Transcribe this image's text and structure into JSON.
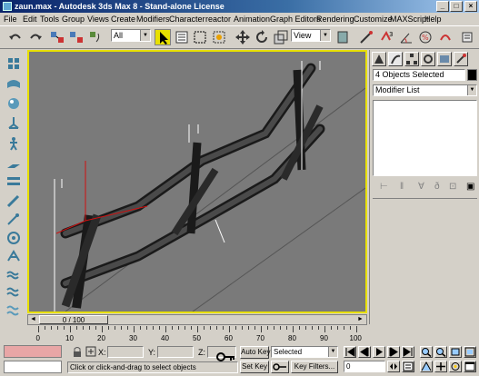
{
  "window": {
    "title": "zaun.max - Autodesk 3ds Max 8  - Stand-alone License",
    "min_glyph": "_",
    "max_glyph": "□",
    "close_glyph": "×"
  },
  "menu": [
    "File",
    "Edit",
    "Tools",
    "Group",
    "Views",
    "Create",
    "Modifiers",
    "Character",
    "reactor",
    "Animation",
    "Graph Editors",
    "Rendering",
    "Customize",
    "MAXScript",
    "Help"
  ],
  "toolbar": {
    "selection_filter": "All",
    "ref_coord": "View"
  },
  "viewport": {
    "label": "",
    "background": "#7a7a7a",
    "active_border": "#e8e000"
  },
  "time_slider": {
    "frame_display": "0 / 100",
    "prev_glyph": "◄",
    "next_glyph": "►"
  },
  "trackbar": {
    "ticks": [
      "0",
      "10",
      "20",
      "30",
      "40",
      "50",
      "60",
      "70",
      "80",
      "90",
      "100"
    ]
  },
  "command_panel": {
    "selection_name": "4 Objects Selected",
    "modifier_list": "Modifier List",
    "object_color": "#000000"
  },
  "status": {
    "prompt": "Click or click-and-drag to select objects",
    "x_label": "X:",
    "y_label": "Y:",
    "z_label": "Z:",
    "auto_key": "Auto Key",
    "set_key": "Set Key",
    "key_mode": "Selected",
    "key_filters": "Key Filters...",
    "current_frame": "0"
  },
  "icons": [
    "undo-icon",
    "redo-icon",
    "link-icon",
    "unlink-icon",
    "bind-icon",
    "select-icon",
    "select-by-name-icon",
    "region-icon",
    "window-crossing-icon",
    "move-icon",
    "rotate-icon",
    "scale-icon",
    "mirror-icon",
    "align-icon",
    "render-icon",
    "quick-render-icon"
  ]
}
